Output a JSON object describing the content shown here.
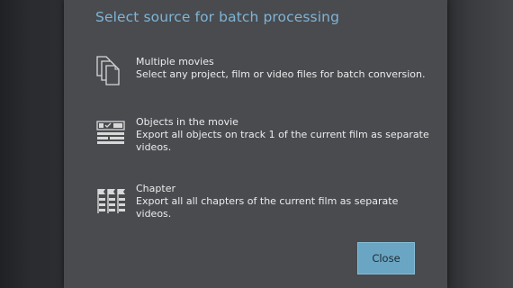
{
  "dialog": {
    "title": "Select source for batch processing",
    "options": [
      {
        "icon": "documents-stack-icon",
        "title": "Multiple movies",
        "description": "Select any project, film or video files for batch conversion."
      },
      {
        "icon": "film-objects-icon",
        "title": "Objects in the movie",
        "description": "Export all objects on track 1 of the current film as separate videos."
      },
      {
        "icon": "chapter-icon",
        "title": "Chapter",
        "description": "Export all all chapters of the current film as separate videos."
      }
    ],
    "close_label": "Close"
  },
  "colors": {
    "title": "#7fb4d6",
    "dialog_bg": "#494b4f",
    "button_bg": "#6aa6c3",
    "text": "#ececec"
  }
}
